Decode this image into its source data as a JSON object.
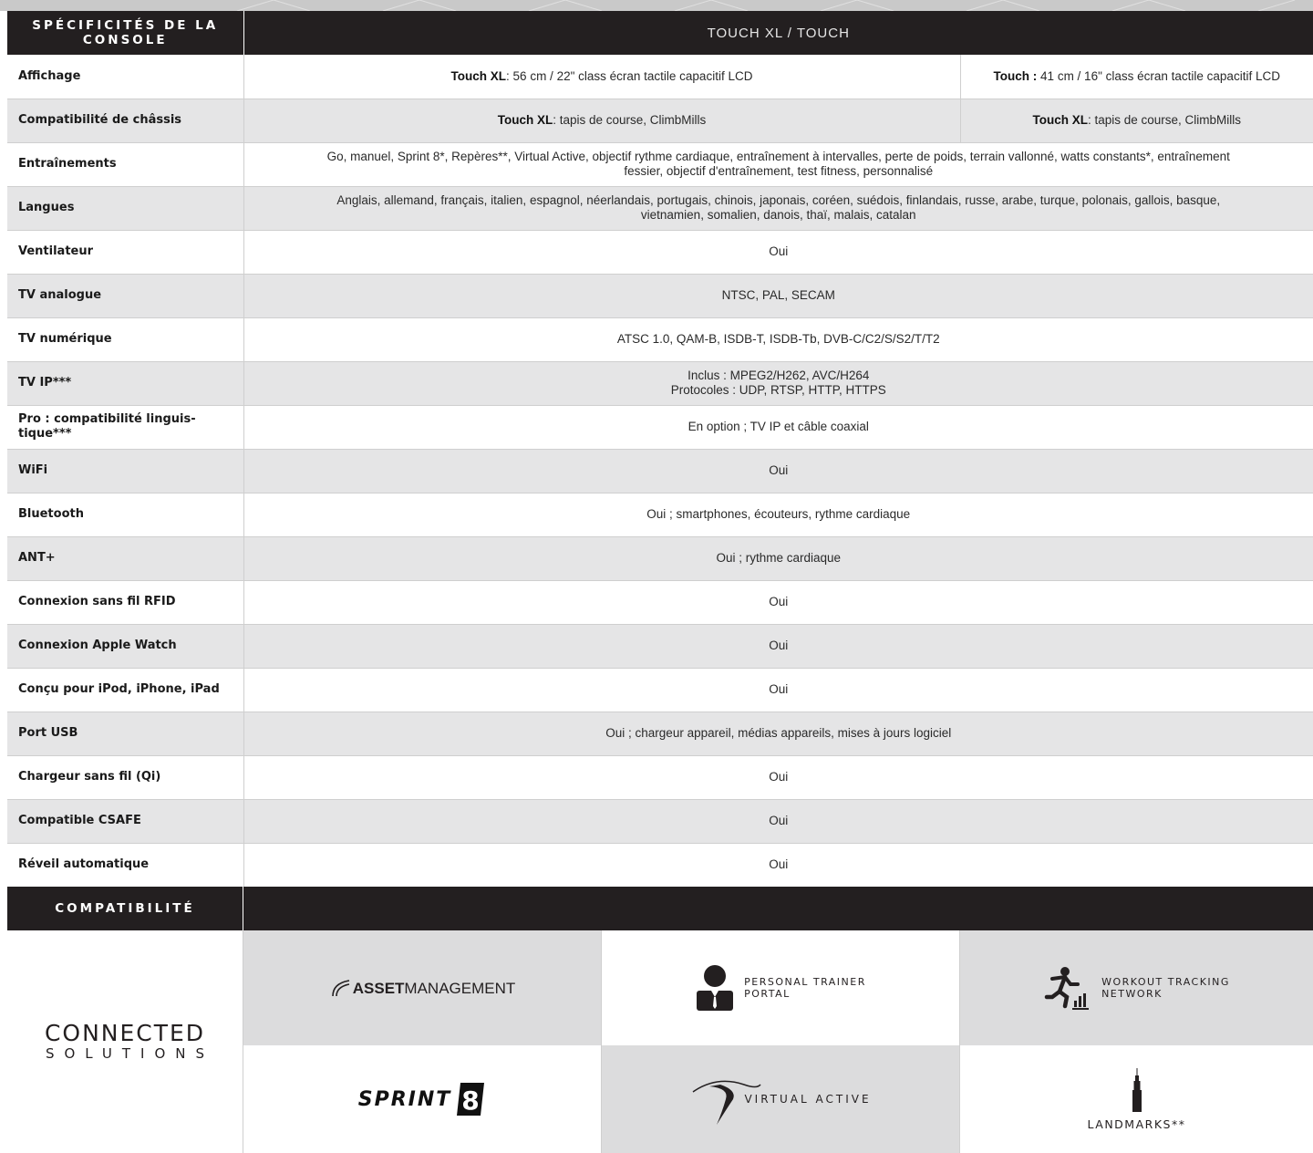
{
  "spec_header": {
    "label": "SPÉCIFICITÉS DE LA CONSOLE",
    "title": "TOUCH XL / TOUCH"
  },
  "rows": [
    {
      "label": "Affichage",
      "a_bold": "Touch XL",
      "a_text": ": 56 cm / 22\" class écran tactile capacitif LCD",
      "b_bold": "Touch :",
      "b_text": " 41 cm / 16\" class écran tactile capacitif LCD"
    },
    {
      "label": "Compatibilité de châssis",
      "a_bold": "Touch XL",
      "a_text": ": tapis de course, ClimbMills",
      "b_bold": "Touch XL",
      "b_text": ": tapis de course, ClimbMills"
    },
    {
      "label": "Entraînements",
      "value_l1": "Go, manuel, Sprint 8*, Repères**, Virtual Active,  objectif rythme cardiaque, entraînement à intervalles, perte de poids, terrain vallonné, watts constants*, entraînement",
      "value_l2": "fessier, objectif d'entraînement, test fitness, personnalisé"
    },
    {
      "label": "Langues",
      "value_l1": "Anglais, allemand, français, italien, espagnol, néerlandais, portugais, chinois, japonais, coréen, suédois, finlandais, russe, arabe, turque, polonais, gallois, basque,",
      "value_l2": "vietnamien, somalien, danois, thaï, malais, catalan"
    },
    {
      "label": "Ventilateur",
      "value": "Oui"
    },
    {
      "label": "TV analogue",
      "value": "NTSC, PAL, SECAM"
    },
    {
      "label": "TV numérique",
      "value": "ATSC 1.0, QAM-B, ISDB-T, ISDB-Tb, DVB-C/C2/S/S2/T/T2"
    },
    {
      "label": "TV IP***",
      "value_l1": "Inclus : MPEG2/H262, AVC/H264",
      "value_l2": "Protocoles : UDP, RTSP, HTTP, HTTPS"
    },
    {
      "label_l1": "Pro : compatibilité linguis-",
      "label_l2": "tique***",
      "value": "En option ; TV IP et câble coaxial"
    },
    {
      "label": "WiFi",
      "value": "Oui"
    },
    {
      "label": "Bluetooth",
      "value": "Oui ; smartphones, écouteurs, rythme cardiaque"
    },
    {
      "label": "ANT+",
      "value": "Oui ; rythme cardiaque"
    },
    {
      "label": "Connexion sans fil RFID",
      "value": "Oui"
    },
    {
      "label": "Connexion Apple Watch",
      "value": "Oui"
    },
    {
      "label": "Conçu pour iPod, iPhone, iPad",
      "value": "Oui"
    },
    {
      "label": "Port USB",
      "value": "Oui ; chargeur appareil, médias appareils, mises à jours logiciel"
    },
    {
      "label": "Chargeur sans fil (Qi)",
      "value": "Oui"
    },
    {
      "label": "Compatible CSAFE",
      "value": "Oui"
    },
    {
      "label": "Réveil automatique",
      "value": "Oui"
    }
  ],
  "compat": {
    "title": "COMPATIBILITÉ",
    "connected_title": "CONNECTED",
    "connected_sub": "SOLUTIONS",
    "asset_bold": "ASSET",
    "asset_rest": " MANAGEMENT",
    "pt_l1": "PERSONAL TRAINER",
    "pt_l2": "PORTAL",
    "wtn_l1": "WORKOUT TRACKING",
    "wtn_l2": "NETWORK",
    "sprint_word": "SPRINT",
    "sprint_num": "8",
    "va_word": "VIRTUAL ACTIVE",
    "landmarks": "LANDMARKS**"
  },
  "colors": {
    "header_bg": "#231f20",
    "row_alt": "#e5e5e6",
    "tile_grey": "#dcdcdd",
    "accent_red": "#c8102e"
  }
}
